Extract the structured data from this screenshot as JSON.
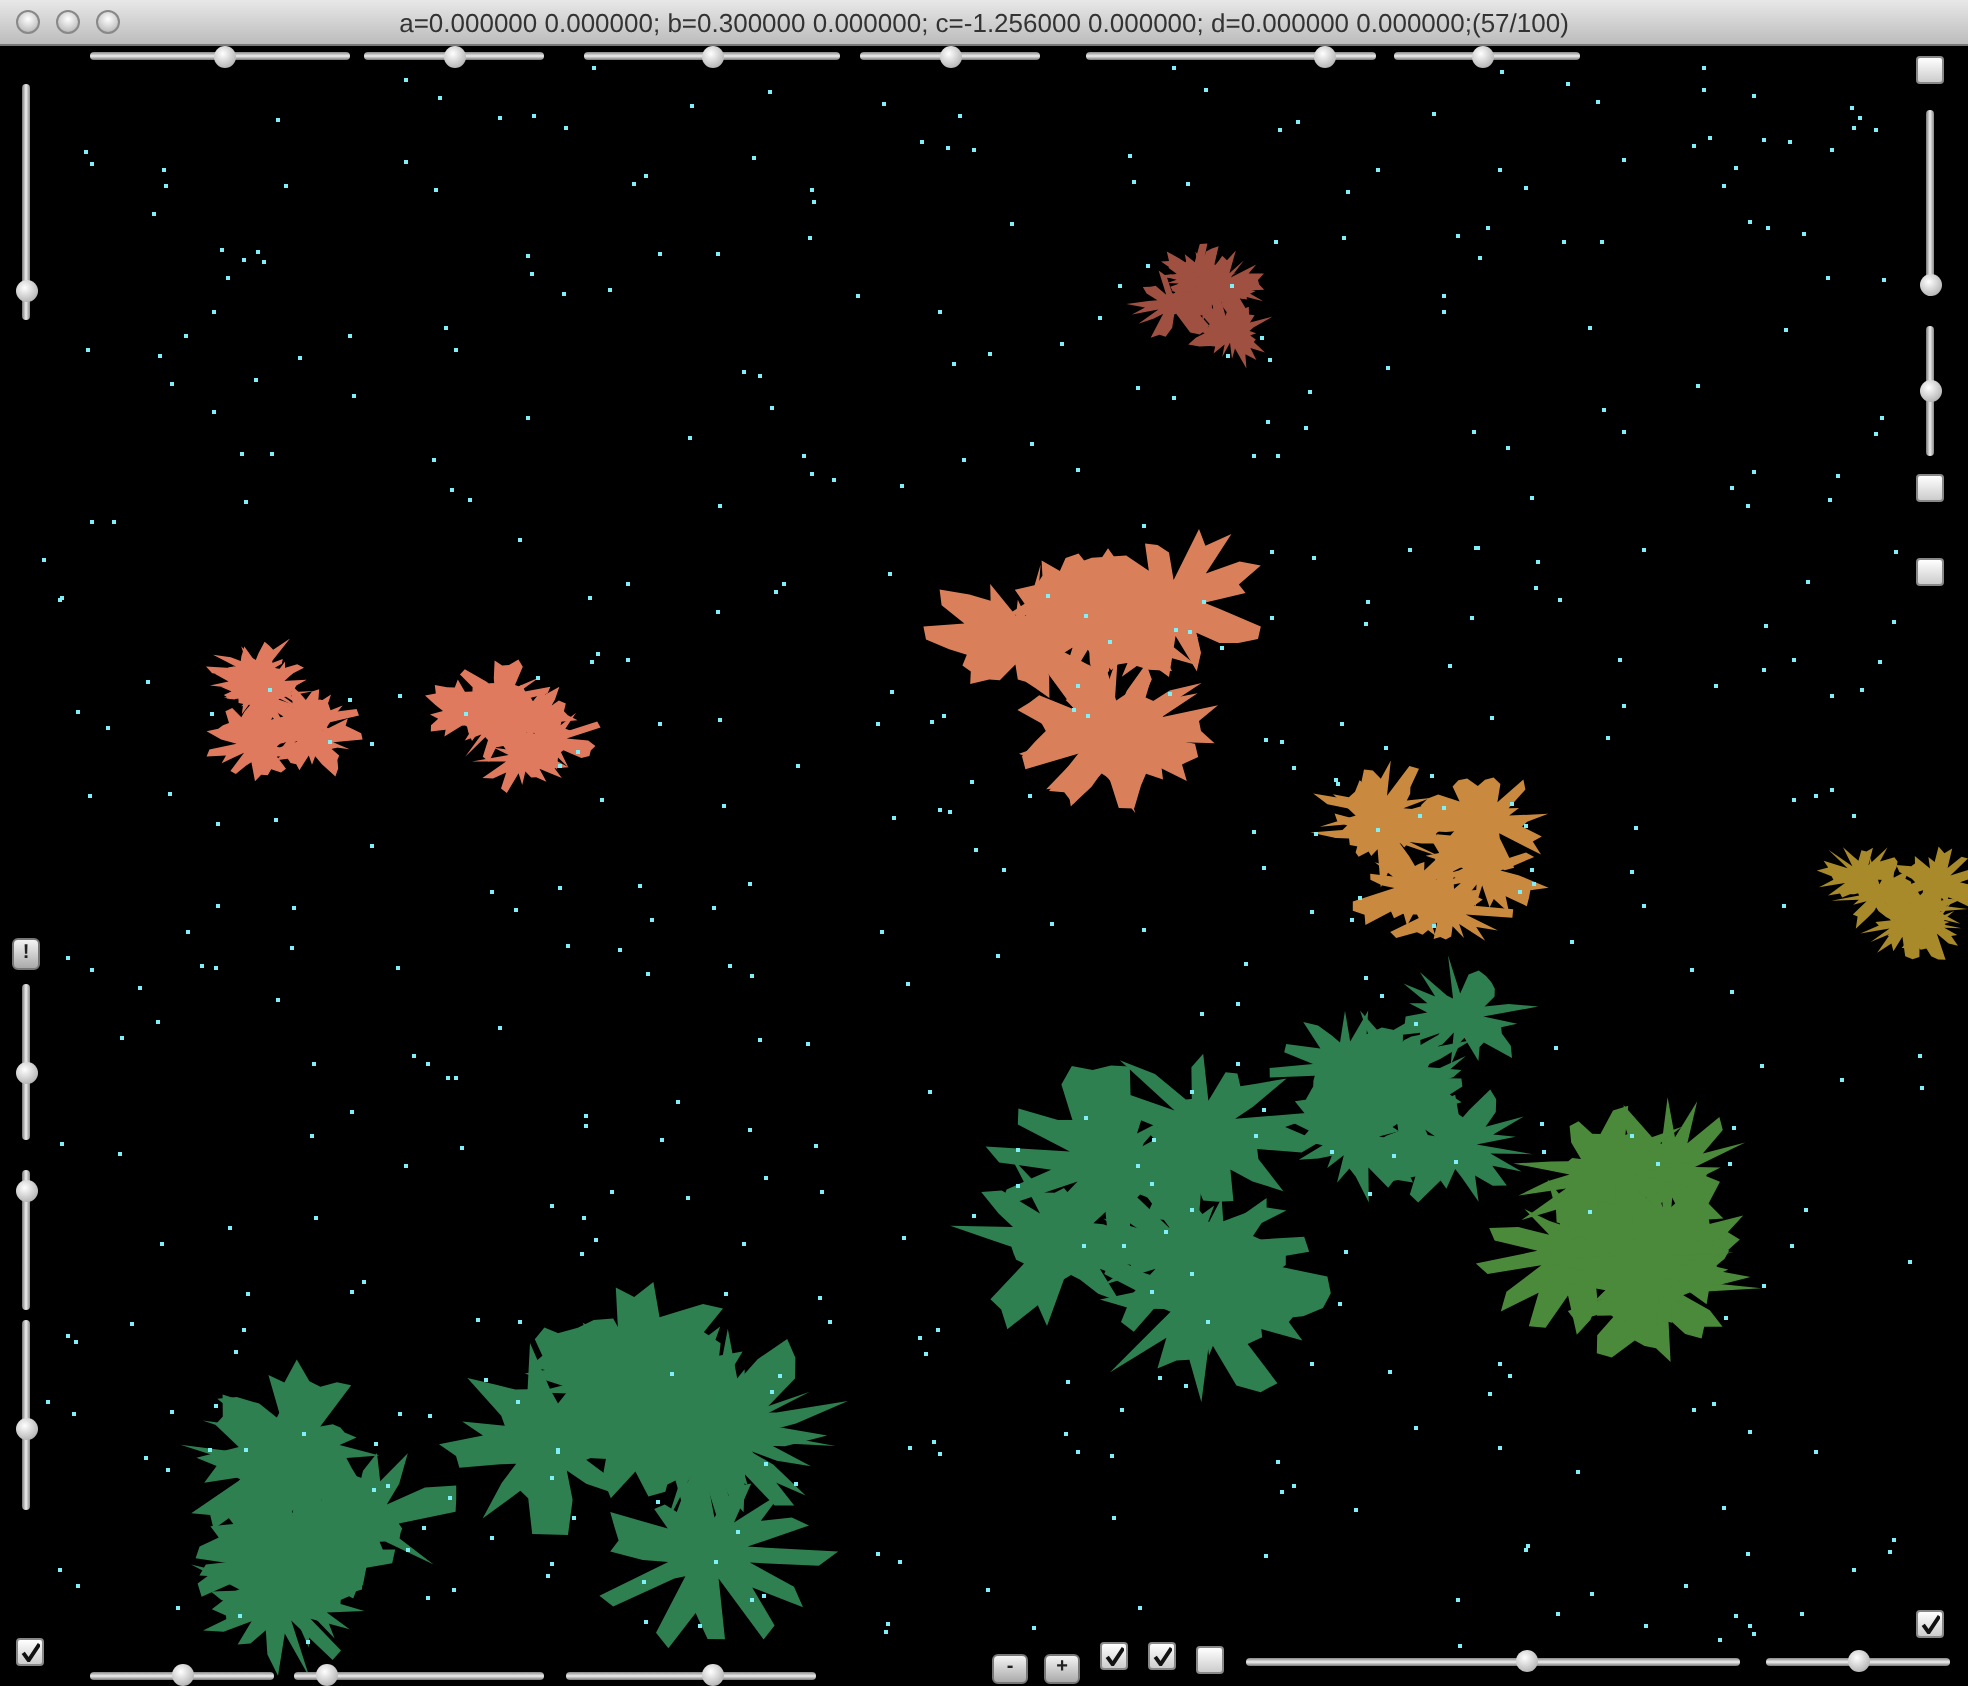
{
  "window": {
    "title": "a=0.000000 0.000000; b=0.300000 0.000000; c=-1.256000 0.000000; d=0.000000 0.000000;(57/100)"
  },
  "top_controls": [
    {
      "kind": "slider",
      "level": 0.52
    },
    {
      "kind": "slider",
      "level": 0.51
    },
    {
      "kind": "slider",
      "level": 0.5
    },
    {
      "kind": "slider",
      "level": 0.5
    },
    {
      "kind": "slider",
      "level": 0.85
    },
    {
      "kind": "slider",
      "level": 0.48
    }
  ],
  "left_controls": [
    {
      "kind": "slider",
      "level": 0.08
    },
    {
      "kind": "button",
      "label": "!"
    },
    {
      "kind": "slider",
      "level": 0.42
    },
    {
      "kind": "slider",
      "level": 0.91
    },
    {
      "kind": "slider",
      "level": 0.42
    },
    {
      "kind": "checkbox",
      "checked": true
    }
  ],
  "right_controls": [
    {
      "kind": "checkbox",
      "checked": false
    },
    {
      "kind": "slider",
      "level": 0.0
    },
    {
      "kind": "slider",
      "level": 0.5
    },
    {
      "kind": "checkbox",
      "checked": false
    },
    {
      "kind": "checkbox",
      "checked": false
    },
    {
      "kind": "checkbox",
      "checked": true
    }
  ],
  "bottom_controls": [
    {
      "kind": "slider",
      "level": 0.5
    },
    {
      "kind": "slider",
      "level": 0.1
    },
    {
      "kind": "slider",
      "level": 0.6
    },
    {
      "kind": "button",
      "label": "-"
    },
    {
      "kind": "button",
      "label": "+"
    },
    {
      "kind": "checkbox",
      "checked": true
    },
    {
      "kind": "checkbox",
      "checked": true
    },
    {
      "kind": "checkbox",
      "checked": false
    },
    {
      "kind": "slider",
      "level": 0.57
    },
    {
      "kind": "slider",
      "level": 0.5
    }
  ]
}
